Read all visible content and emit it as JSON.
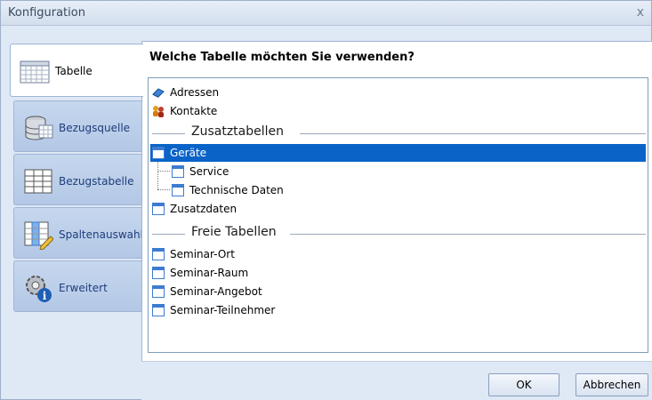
{
  "window": {
    "title": "Konfiguration",
    "close_glyph": "x"
  },
  "tabs": [
    {
      "label": "Tabelle",
      "icon": "table-grid-icon",
      "active": true
    },
    {
      "label": "Bezugsquelle",
      "icon": "database-icon",
      "active": false
    },
    {
      "label": "Bezugstabelle",
      "icon": "grid-icon",
      "active": false
    },
    {
      "label": "Spaltenauswahl",
      "icon": "column-select-icon",
      "active": false
    },
    {
      "label": "Erweitert",
      "icon": "gear-info-icon",
      "active": false
    }
  ],
  "main": {
    "heading": "Welche Tabelle möchten Sie verwenden?",
    "list": {
      "items": [
        {
          "label": "Adressen",
          "icon": "address-book-icon"
        },
        {
          "label": "Kontakte",
          "icon": "contacts-icon"
        }
      ],
      "groups": [
        {
          "label": "Zusatztabellen",
          "items": [
            {
              "label": "Geräte",
              "selected": true,
              "level": 0
            },
            {
              "label": "Service",
              "selected": false,
              "level": 1
            },
            {
              "label": "Technische Daten",
              "selected": false,
              "level": 1
            },
            {
              "label": "Zusatzdaten",
              "selected": false,
              "level": 0
            }
          ]
        },
        {
          "label": "Freie Tabellen",
          "items": [
            {
              "label": "Seminar-Ort"
            },
            {
              "label": "Seminar-Raum"
            },
            {
              "label": "Seminar-Angebot"
            },
            {
              "label": "Seminar-Teilnehmer"
            }
          ]
        }
      ]
    }
  },
  "footer": {
    "ok_label": "OK",
    "cancel_label": "Abbrechen"
  },
  "colors": {
    "selection": "#0a64c8",
    "tab_text": "#1e3d7a",
    "frame": "#dfe8f5"
  }
}
